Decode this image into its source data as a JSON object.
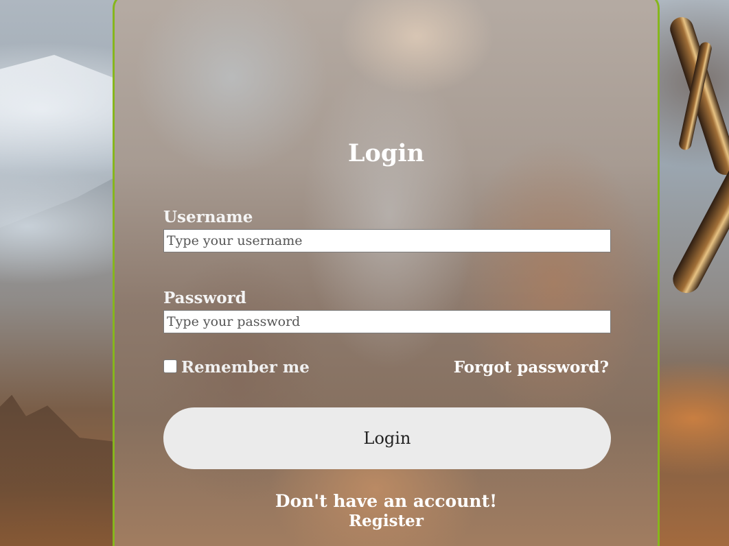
{
  "colors": {
    "card_border": "#86b61c",
    "button_background": "#ebebeb",
    "text_light": "#ffffff"
  },
  "login_form": {
    "title": "Login",
    "username": {
      "label": "Username",
      "placeholder": "Type your username",
      "value": ""
    },
    "password": {
      "label": "Password",
      "placeholder": "Type your password",
      "value": ""
    },
    "remember_me": {
      "label": "Remember me",
      "checked": false
    },
    "forgot_password_link": "Forgot password?",
    "submit_label": "Login",
    "no_account_text": "Don't have an account!",
    "register_link": "Register"
  }
}
